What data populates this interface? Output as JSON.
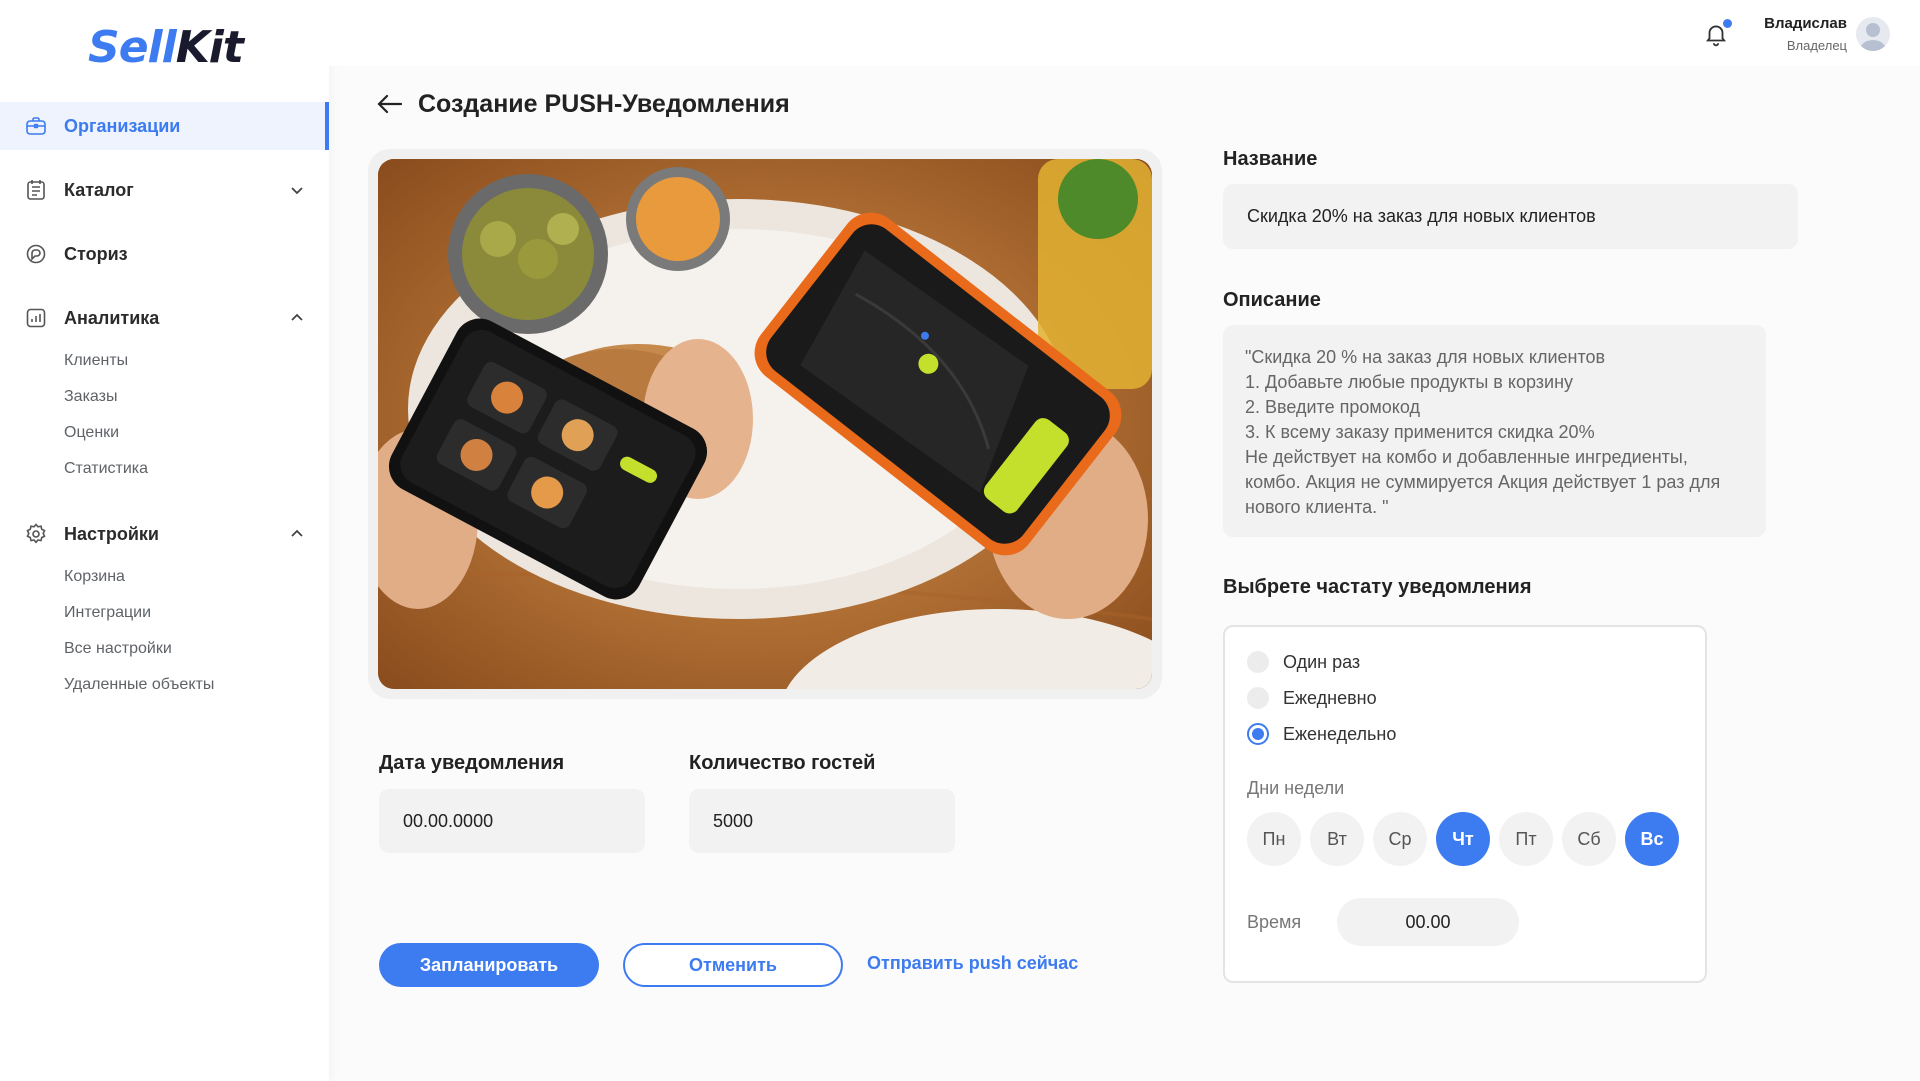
{
  "logo": {
    "part1": "Sell",
    "part2": "Kit"
  },
  "sidebar": {
    "items": [
      {
        "label": "Организации",
        "icon": "briefcase-icon",
        "active": true
      },
      {
        "label": "Каталог",
        "icon": "catalog-icon",
        "chevron": "down"
      },
      {
        "label": "Сториз",
        "icon": "stories-icon"
      },
      {
        "label": "Аналитика",
        "icon": "analytics-icon",
        "chevron": "up",
        "sub": [
          "Клиенты",
          "Заказы",
          "Оценки",
          "Статистика"
        ]
      },
      {
        "label": "Настройки",
        "icon": "gear-icon",
        "chevron": "up",
        "sub": [
          "Корзина",
          "Интеграции",
          "Все настройки",
          "Удаленные объекты"
        ]
      }
    ]
  },
  "header": {
    "user_name": "Владислав",
    "user_role": "Владелец",
    "notification_icon": "bell-icon"
  },
  "page": {
    "title": "Создание PUSH-Уведомления"
  },
  "form": {
    "name_label": "Название",
    "name_value": "Скидка 20% на заказ для новых клиентов",
    "description_label": "Описание",
    "description_value": "\"Скидка 20 % на заказ для новых клиентов\n 1. Добавьте любые продукты в корзину\n 2. Введите промокод\n 3. К всему заказу применится скидка 20%\nНе действует на комбо и добавленные ингредиенты, комбо. Акция не суммируется Акция действует 1 раз для нового клиента. \"",
    "date_label": "Дата уведомления",
    "date_value": "00.00.0000",
    "guests_label": "Количество гостей",
    "guests_value": "5000"
  },
  "frequency": {
    "label": "Выбрете частату уведомления",
    "options": [
      "Один раз",
      "Ежедневно",
      "Еженедельно"
    ],
    "selected": "Еженедельно",
    "days_label": "Дни недели",
    "days": [
      "Пн",
      "Вт",
      "Ср",
      "Чт",
      "Пт",
      "Сб",
      "Вс"
    ],
    "selected_days": [
      "Чт",
      "Вс"
    ],
    "time_label": "Время",
    "time_value": "00.00"
  },
  "actions": {
    "schedule": "Запланировать",
    "cancel": "Отменить",
    "send_now": "Отправить push сейчас"
  },
  "colors": {
    "accent": "#3d7bf0",
    "field_bg": "#f2f2f2"
  }
}
